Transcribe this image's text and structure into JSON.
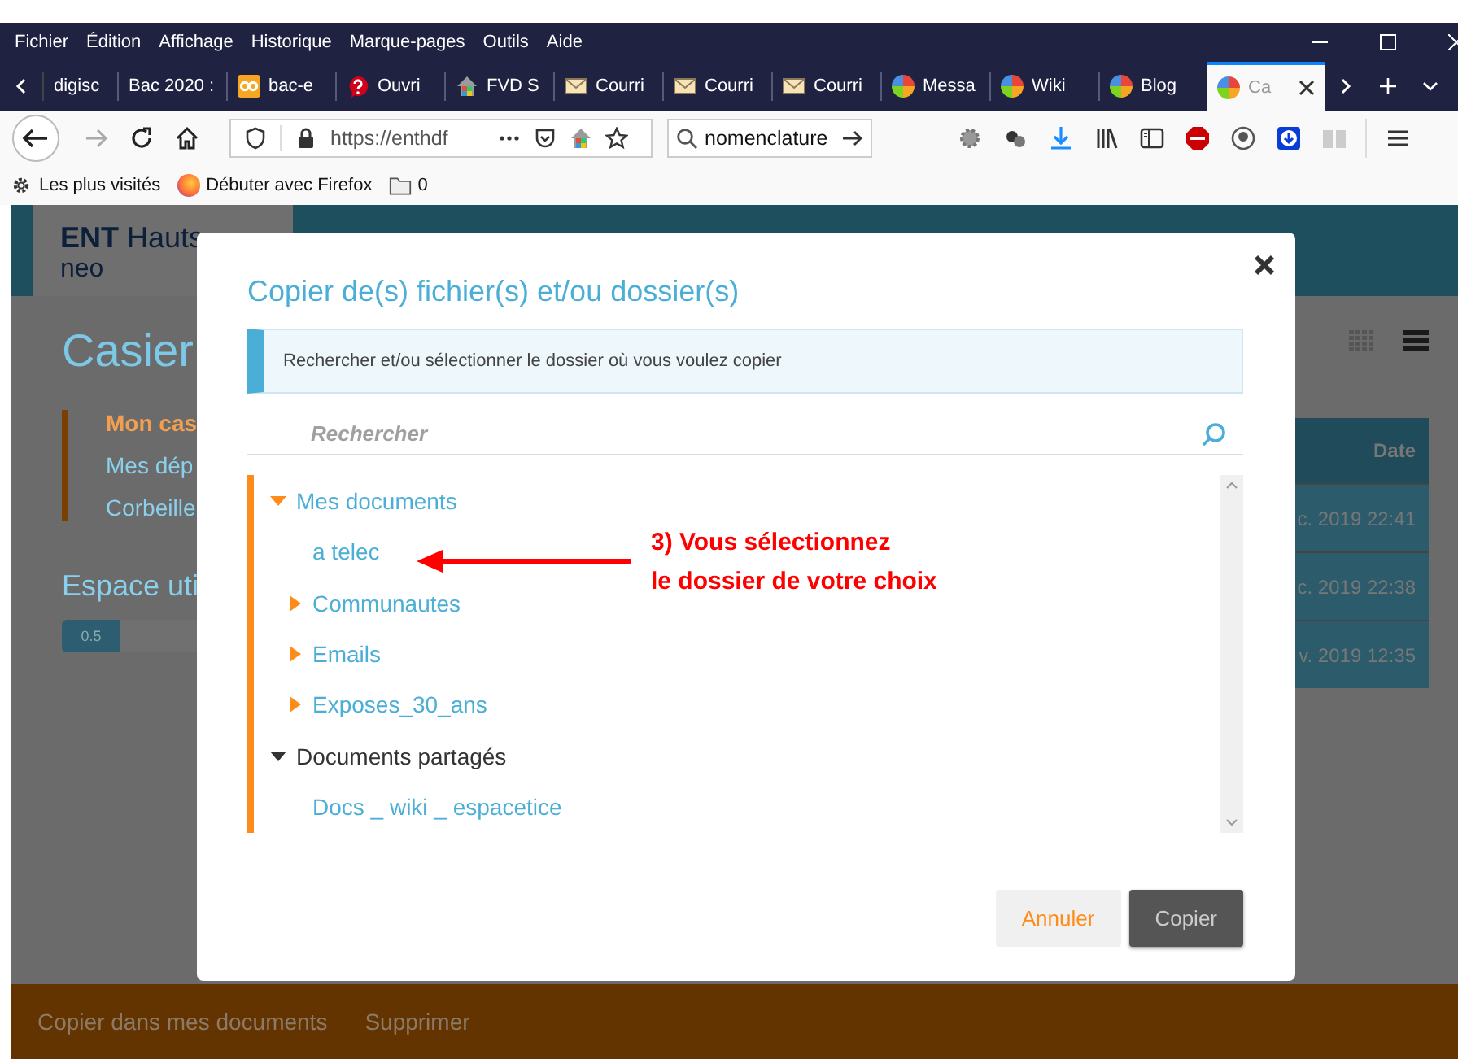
{
  "menu_bar": [
    "Fichier",
    "Édition",
    "Affichage",
    "Historique",
    "Marque-pages",
    "Outils",
    "Aide"
  ],
  "tabs": [
    {
      "title": "digisc",
      "kind": "plain",
      "selected": false
    },
    {
      "title": "Bac 2020 :",
      "kind": "plain",
      "selected": false
    },
    {
      "title": "bac-e",
      "kind": "infinity",
      "selected": false
    },
    {
      "title": "Ouvri",
      "kind": "help",
      "selected": false
    },
    {
      "title": "FVD S",
      "kind": "house",
      "selected": false
    },
    {
      "title": "Courri",
      "kind": "mail",
      "selected": false
    },
    {
      "title": "Courri",
      "kind": "mail",
      "selected": false
    },
    {
      "title": "Courri",
      "kind": "mail",
      "selected": false
    },
    {
      "title": "Messa",
      "kind": "globe",
      "selected": false
    },
    {
      "title": "Wiki",
      "kind": "globe",
      "selected": false
    },
    {
      "title": "Blog",
      "kind": "globe",
      "selected": false
    },
    {
      "title": "Ca",
      "kind": "globe",
      "selected": true
    }
  ],
  "url_bar": {
    "value": "https://enthdf"
  },
  "search_bar": {
    "value": "nomenclature"
  },
  "bookmarks": [
    {
      "label": "Les plus visités",
      "kind": "gear"
    },
    {
      "label": "Débuter avec Firefox",
      "kind": "firefox"
    },
    {
      "label": "0",
      "kind": "folder"
    }
  ],
  "page": {
    "logo": "ENT",
    "logo_rest": "Hauts",
    "logo_sub": "neo",
    "title": "Casier",
    "nav": [
      {
        "label": "Mon cas",
        "selected": true
      },
      {
        "label": "Mes dép",
        "selected": false
      },
      {
        "label": "Corbeille",
        "selected": false
      }
    ],
    "storage": {
      "label": "Espace uti",
      "reading": "0.5",
      "level": 0.12
    },
    "table": {
      "header": "Date",
      "rows": [
        "c. 2019 22:41",
        "c. 2019 22:38",
        "v. 2019 12:35"
      ]
    },
    "footer_actions": [
      "Copier dans mes documents",
      "Supprimer"
    ]
  },
  "dialog": {
    "title": "Copier de(s) fichier(s) et/ou dossier(s)",
    "info": "Rechercher et/ou sélectionner le dossier où vous voulez copier",
    "search": {
      "placeholder": "Rechercher"
    },
    "tree": [
      {
        "name": "Mes documents",
        "kind": "mine",
        "expanded": true,
        "children": [
          {
            "name": "a telec",
            "kind": "mine"
          },
          {
            "name": "Communautes",
            "kind": "mine",
            "expanded": false
          },
          {
            "name": "Emails",
            "kind": "mine",
            "expanded": false
          },
          {
            "name": "Exposes_30_ans",
            "kind": "mine",
            "expanded": false
          }
        ]
      },
      {
        "name": "Documents partagés",
        "kind": "shared",
        "expanded": true,
        "children": [
          {
            "name": "Docs _ wiki _ espacetice",
            "kind": "mine"
          }
        ]
      }
    ],
    "buttons": [
      {
        "label": "Annuler",
        "kind": "secondary"
      },
      {
        "label": "Copier",
        "kind": "primary"
      }
    ]
  },
  "annotation": {
    "lines": [
      "3) Vous sélectionnez",
      "le dossier de votre choix"
    ]
  }
}
